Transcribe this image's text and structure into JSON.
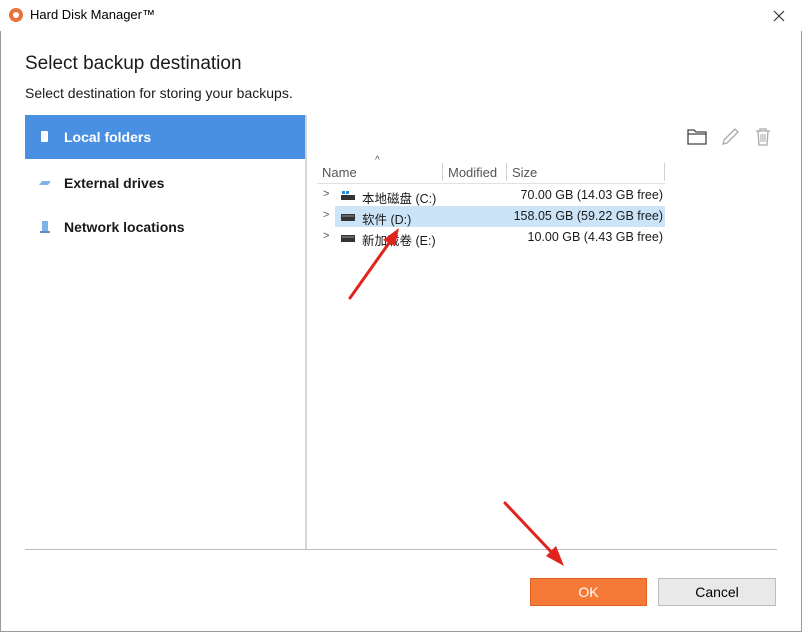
{
  "window": {
    "title": "Hard Disk Manager™"
  },
  "page": {
    "heading": "Select backup destination",
    "subheading": "Select destination for storing your backups."
  },
  "nav": {
    "items": [
      {
        "label": "Local folders",
        "active": true
      },
      {
        "label": "External drives",
        "active": false
      },
      {
        "label": "Network locations",
        "active": false
      }
    ]
  },
  "toolbar": {
    "icons": [
      "new-folder-icon",
      "rename-icon",
      "delete-icon"
    ]
  },
  "list": {
    "columns": [
      "Name",
      "Modified",
      "Size"
    ],
    "rows": [
      {
        "name": "本地磁盘 (C:)",
        "modified": "",
        "size": "70.00 GB (14.03 GB free)",
        "selected": false,
        "icon": "system-drive-icon"
      },
      {
        "name": "软件 (D:)",
        "modified": "",
        "size": "158.05 GB (59.22 GB free)",
        "selected": true,
        "icon": "drive-icon"
      },
      {
        "name": "新加载卷 (E:)",
        "modified": "",
        "size": "10.00 GB (4.43 GB free)",
        "selected": false,
        "icon": "drive-icon"
      }
    ]
  },
  "buttons": {
    "ok": "OK",
    "cancel": "Cancel"
  },
  "colors": {
    "accent": "#4a90e2",
    "ok": "#f57a38",
    "selected_row": "#cce4f7",
    "annotation_arrow": "#e0231c"
  }
}
